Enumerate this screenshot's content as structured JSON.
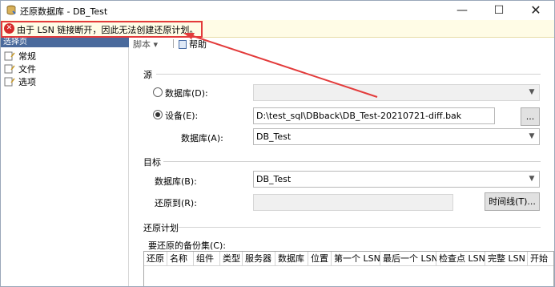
{
  "window": {
    "title": "还原数据库 - DB_Test",
    "minimize": "—",
    "maximize": "☐",
    "close": "✕"
  },
  "error": {
    "icon": "✕",
    "message": "由于 LSN 链接断开，因此无法创建还原计划。"
  },
  "left": {
    "header": "选择页",
    "items": [
      {
        "label": "常规",
        "icon": "page-icon"
      },
      {
        "label": "文件",
        "icon": "page-icon"
      },
      {
        "label": "选项",
        "icon": "page-icon"
      }
    ]
  },
  "toolbar": {
    "script": "脚本 ▾",
    "help": "帮助"
  },
  "source": {
    "title": "源",
    "database_radio": "数据库(D):",
    "device_radio": "设备(E):",
    "device_path": "D:\\test_sql\\DBback\\DB_Test-20210721-diff.bak",
    "browse": "...",
    "database_label": "数据库(A):",
    "database_value": "DB_Test"
  },
  "target": {
    "title": "目标",
    "database_label": "数据库(B):",
    "database_value": "DB_Test",
    "restore_to_label": "还原到(R):",
    "restore_to_value": "",
    "timeline_button": "时间线(T)..."
  },
  "plan": {
    "title": "还原计划",
    "backup_sets_label": "要还原的备份集(C):",
    "columns": [
      "还原",
      "名称",
      "组件",
      "类型",
      "服务器",
      "数据库",
      "位置",
      "第一个 LSN",
      "最后一个 LSN",
      "检查点 LSN",
      "完整 LSN",
      "开始"
    ]
  },
  "colors": {
    "error_border": "#e33b3b",
    "error_bg": "#fffce6",
    "selection_header": "#4a6a9c"
  }
}
